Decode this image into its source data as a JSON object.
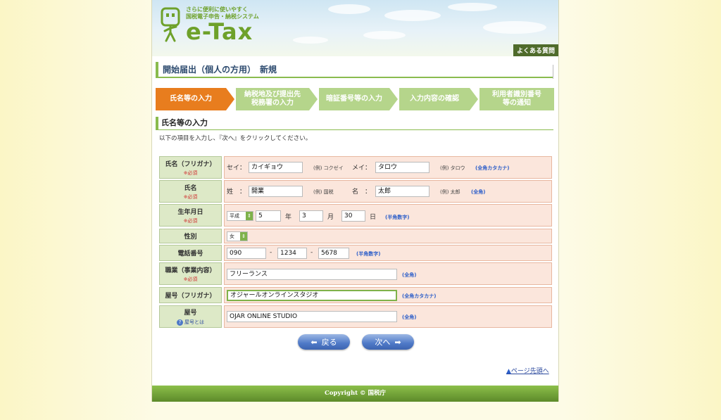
{
  "header": {
    "tagline_line1": "さらに便利に使いやすく",
    "tagline_line2": "国税電子申告・納税システム",
    "logo_text": "e-Tax",
    "faq_label": "よくある質問"
  },
  "page_title": "開始届出（個人の方用）　新規",
  "steps": [
    {
      "label": "氏名等の入力",
      "active": true
    },
    {
      "label_line1": "納税地及び提出先",
      "label_line2": "税務署の入力",
      "active": false
    },
    {
      "label": "暗証番号等の入力",
      "active": false
    },
    {
      "label": "入力内容の確認",
      "active": false
    },
    {
      "label_line1": "利用者識別番号",
      "label_line2": "等の通知",
      "active": false
    }
  ],
  "section_title": "氏名等の入力",
  "instruction": "以下の項目を入力し、『次へ』をクリックしてください。",
  "required_mark": "※必須",
  "form": {
    "furigana": {
      "label": "氏名（フリガナ）",
      "sei_label": "セイ：",
      "sei_value": "カイギョウ",
      "sei_example": "(例) コクゼイ",
      "mei_label": "メイ：",
      "mei_value": "タロウ",
      "mei_example": "(例) タロウ",
      "hint": "(全角カタカナ)"
    },
    "name": {
      "label": "氏名",
      "sei_label": "姓　：",
      "sei_value": "開業",
      "sei_example": "(例) 国税",
      "mei_label": "名　：",
      "mei_value": "太郎",
      "mei_example": "(例) 太郎",
      "hint": "(全角)"
    },
    "birthday": {
      "label": "生年月日",
      "era": "平成",
      "year": "5",
      "year_unit": "年",
      "month": "3",
      "month_unit": "月",
      "day": "30",
      "day_unit": "日",
      "hint": "(半角数字)"
    },
    "gender": {
      "label": "性別",
      "value": "女"
    },
    "phone": {
      "label": "電話番号",
      "part1": "090",
      "sep": "-",
      "part2": "1234",
      "part3": "5678",
      "hint": "(半角数字)"
    },
    "occupation": {
      "label": "職業（事業内容）",
      "value": "フリーランス",
      "hint": "(全角)"
    },
    "trade_name_kana": {
      "label": "屋号（フリガナ）",
      "value": "オジャールオンラインスタジオ",
      "hint": "(全角カタカナ)"
    },
    "trade_name": {
      "label": "屋号",
      "help_link": "屋号とは",
      "value": "OJAR ONLINE STUDIO",
      "hint": "(全角)"
    }
  },
  "buttons": {
    "back": "戻る",
    "next": "次へ"
  },
  "page_top_link": "ページ先頭へ",
  "footer": "Copyright © 国税庁",
  "colors": {
    "accent_green": "#8abb4e",
    "active_step": "#e87d1e",
    "inactive_step": "#b5d58b",
    "button_blue": "#4e79c7"
  }
}
